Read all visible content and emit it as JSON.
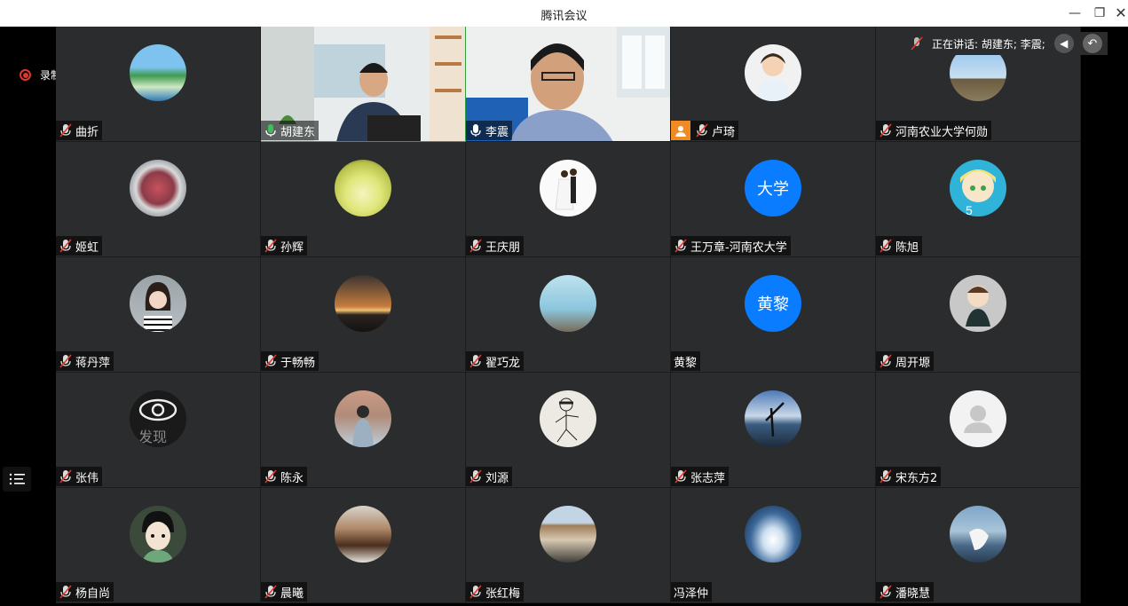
{
  "window": {
    "title": "腾讯会议"
  },
  "recording": {
    "label": "录制中"
  },
  "speaking": {
    "label": "正在讲话: 胡建东; 李震;"
  },
  "participants": [
    {
      "name": "曲折",
      "avatar": "landscape",
      "mic": "muted"
    },
    {
      "name": "胡建东",
      "avatar": "video-man",
      "mic": "on",
      "speaking": true
    },
    {
      "name": "李震",
      "avatar": "video-man2",
      "mic": "on"
    },
    {
      "name": "卢琦",
      "avatar": "portrait",
      "mic": "muted",
      "host": true
    },
    {
      "name": "河南农业大学何勋",
      "avatar": "building",
      "mic": "muted"
    },
    {
      "name": "姬虹",
      "avatar": "food",
      "mic": "muted"
    },
    {
      "name": "孙辉",
      "avatar": "cabbage",
      "mic": "muted"
    },
    {
      "name": "王庆朋",
      "avatar": "wedding",
      "mic": "muted"
    },
    {
      "name": "王万章-河南农大学",
      "avatar": "text",
      "avatar_text": "大学",
      "mic": "muted"
    },
    {
      "name": "陈旭",
      "avatar": "anime",
      "mic": "muted"
    },
    {
      "name": "蒋丹萍",
      "avatar": "woman",
      "mic": "muted"
    },
    {
      "name": "于畅畅",
      "avatar": "sunset",
      "mic": "muted"
    },
    {
      "name": "翟巧龙",
      "avatar": "sky",
      "mic": "muted"
    },
    {
      "name": "黄黎",
      "avatar": "text",
      "avatar_text": "黄黎",
      "mic": "none"
    },
    {
      "name": "周开塬",
      "avatar": "cartoon",
      "mic": "muted"
    },
    {
      "name": "张伟",
      "avatar": "eye",
      "avatar_text": "发现",
      "mic": "muted"
    },
    {
      "name": "陈永",
      "avatar": "person-back",
      "mic": "muted"
    },
    {
      "name": "刘源",
      "avatar": "sketch",
      "mic": "muted"
    },
    {
      "name": "张志萍",
      "avatar": "seaman",
      "mic": "muted"
    },
    {
      "name": "宋东方2",
      "avatar": "default",
      "mic": "muted"
    },
    {
      "name": "杨自尚",
      "avatar": "boy",
      "mic": "muted"
    },
    {
      "name": "晨曦",
      "avatar": "kitchen",
      "mic": "muted"
    },
    {
      "name": "张红梅",
      "avatar": "city",
      "mic": "muted"
    },
    {
      "name": "冯泽仲",
      "avatar": "wave",
      "mic": "none"
    },
    {
      "name": "潘晓慧",
      "avatar": "bird",
      "mic": "muted"
    }
  ],
  "colors": {
    "accent": "#0a7cff",
    "speaking": "#2ea043",
    "record": "#e0382f",
    "tile": "#2b2c2e"
  }
}
